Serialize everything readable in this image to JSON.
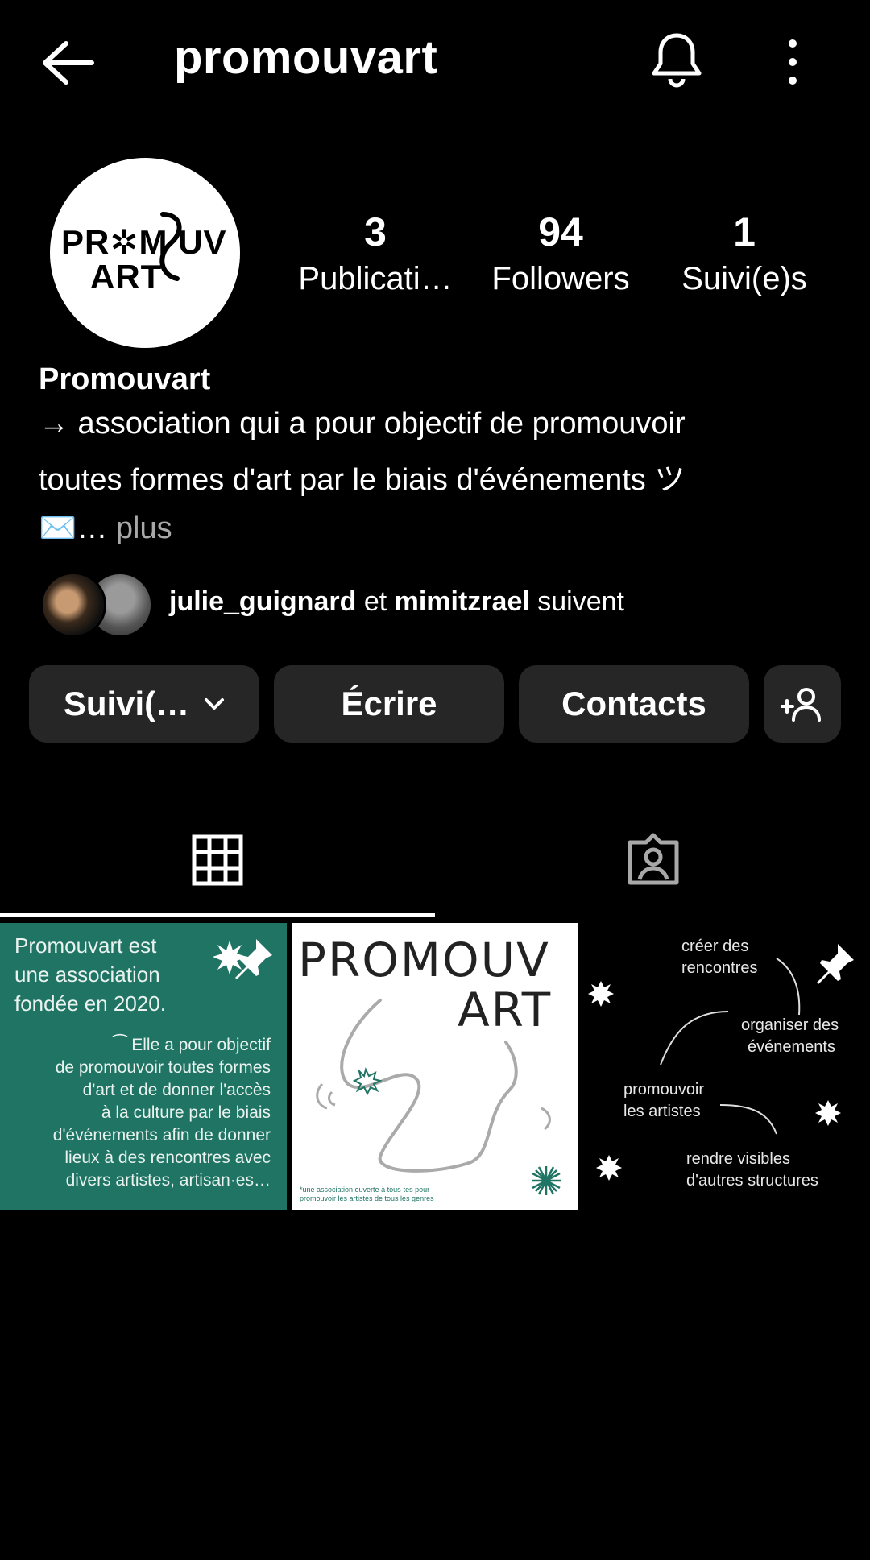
{
  "header": {
    "title": "promouvart",
    "icons": [
      "back-arrow-icon",
      "bell-icon",
      "more-vertical-icon"
    ]
  },
  "profile": {
    "avatar_logo_line1": "PR✲M UV",
    "avatar_logo_line2": "ART",
    "stats": [
      {
        "value": "3",
        "label": "Publicati…"
      },
      {
        "value": "94",
        "label": "Followers"
      },
      {
        "value": "1",
        "label": "Suivi(e)s"
      }
    ]
  },
  "bio": {
    "name": "Promouvart",
    "line1": "→ association qui a pour objectif de promouvoir",
    "line2": "toutes formes d'art par le biais d'événements ツ",
    "line3_prefix": "✉️…",
    "more": "plus"
  },
  "followed_by": {
    "user1": "julie_guignard",
    "connector": "et",
    "user2": "mimitzrael",
    "suffix": "suivent"
  },
  "actions": {
    "following": "Suivi(…",
    "message": "Écrire",
    "contacts": "Contacts"
  },
  "tabs": [
    {
      "name": "grid",
      "icon": "grid-icon",
      "active": true
    },
    {
      "name": "tagged",
      "icon": "tagged-person-icon",
      "active": false
    }
  ],
  "posts": {
    "post1": {
      "heading": [
        "Promouvart est",
        "une association",
        "fondée en 2020."
      ],
      "body": [
        "⁀ Elle a pour objectif",
        "de promouvoir toutes formes",
        "d'art et de donner l'accès",
        "à la culture par le biais",
        "d'événements afin de donner",
        "lieux à des rencontres avec",
        "divers artistes, artisan·es…"
      ],
      "pinned": true
    },
    "post2": {
      "title_line1": "PROMOUV",
      "title_line2": "ART",
      "footnote": [
        "*une association ouverte à tous·tes pour",
        "promouvoir les artistes de tous les genres"
      ]
    },
    "post3": {
      "labels": [
        "créer des",
        "rencontres",
        "organiser des",
        "événements",
        "promouvoir",
        "les artistes",
        "rendre visibles",
        "d'autres structures"
      ],
      "pinned": true
    }
  },
  "colors": {
    "background": "#000000",
    "button": "#262626",
    "post_green": "#1f7464",
    "muted_text": "#a8a8a8"
  }
}
